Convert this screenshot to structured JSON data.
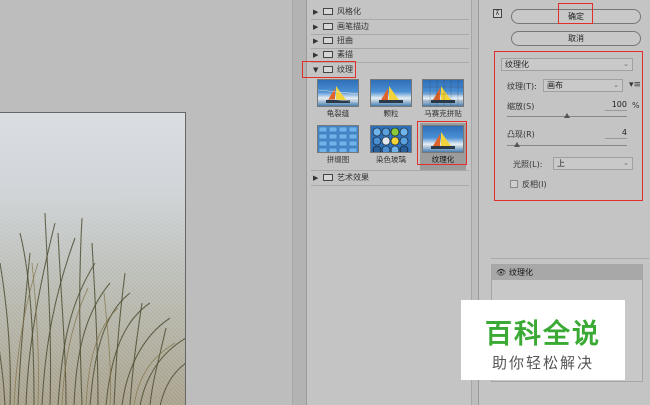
{
  "gallery": {
    "categories": [
      {
        "label": "风格化",
        "expanded": false
      },
      {
        "label": "画笔描边",
        "expanded": false
      },
      {
        "label": "扭曲",
        "expanded": false
      },
      {
        "label": "素描",
        "expanded": false
      },
      {
        "label": "纹理",
        "expanded": true
      },
      {
        "label": "艺术效果",
        "expanded": false
      }
    ],
    "texture_filters": [
      {
        "label": "龟裂缝",
        "selected": false
      },
      {
        "label": "颗粒",
        "selected": false
      },
      {
        "label": "马赛克拼贴",
        "selected": false
      },
      {
        "label": "拼缀图",
        "selected": false
      },
      {
        "label": "染色玻璃",
        "selected": false
      },
      {
        "label": "纹理化",
        "selected": true
      }
    ]
  },
  "buttons": {
    "ok": "确定",
    "cancel": "取消"
  },
  "filter_panel": {
    "filter_select": "纹理化",
    "texture_label": "纹理(T):",
    "texture_value": "画布",
    "scaling_label": "缩放(S)",
    "scaling_value": "100",
    "scaling_unit": "%",
    "scaling_level": 0.5,
    "relief_label": "凸现(R)",
    "relief_value": "4",
    "relief_level": 0.08,
    "light_label": "光照(L):",
    "light_value": "上",
    "invert_label": "反相(I)",
    "invert_checked": false
  },
  "layers": {
    "items": [
      {
        "name": "纹理化",
        "visible": true
      }
    ]
  },
  "watermark": {
    "title": "百科全说",
    "subtitle": "助你轻松解决"
  },
  "colors": {
    "highlight_box": "#e0302c",
    "watermark_green": "#3aaa35"
  },
  "icons": {
    "eye": "eye-icon",
    "folder": "folder-icon",
    "collapse": "collapse-icon"
  }
}
